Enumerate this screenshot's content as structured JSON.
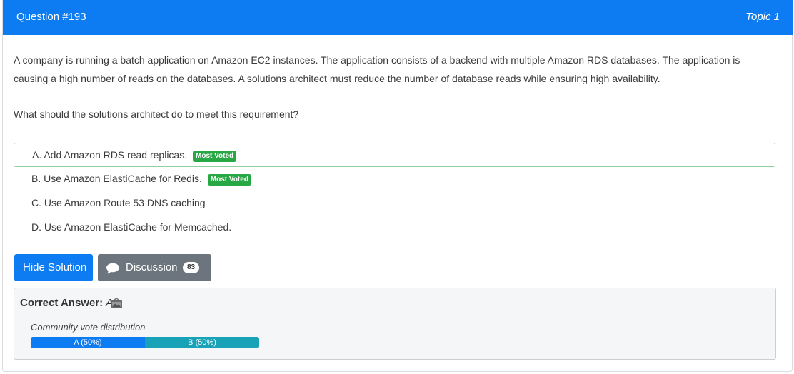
{
  "header": {
    "title": "Question #193",
    "topic": "Topic 1",
    "bg_color": "#0d7bf2"
  },
  "question": {
    "text": "A company is running a batch application on Amazon EC2 instances. The application consists of a backend with multiple Amazon RDS databases. The application is causing a high number of reads on the databases. A solutions architect must reduce the number of database reads while ensuring high availability.",
    "prompt": "What should the solutions architect do to meet this requirement?"
  },
  "choices": [
    {
      "text": "A. Add Amazon RDS read replicas.",
      "badge": "Most Voted"
    },
    {
      "text": "B. Use Amazon ElastiCache for Redis.",
      "badge": "Most Voted"
    },
    {
      "text": "C. Use Amazon Route 53 DNS caching"
    },
    {
      "text": "D. Use Amazon ElastiCache for Memcached."
    }
  ],
  "buttons": {
    "hide_solution": "Hide Solution",
    "discussion": "Discussion",
    "discussion_count": "83"
  },
  "answer": {
    "label": "Correct Answer:",
    "value": "A",
    "vote_title": "Community vote distribution",
    "votes": [
      {
        "label": "A (50%)",
        "fraction": 0.5,
        "color": "#0d7bf2"
      },
      {
        "label": "B (50%)",
        "fraction": 0.5,
        "color": "#17a2b8"
      }
    ]
  }
}
